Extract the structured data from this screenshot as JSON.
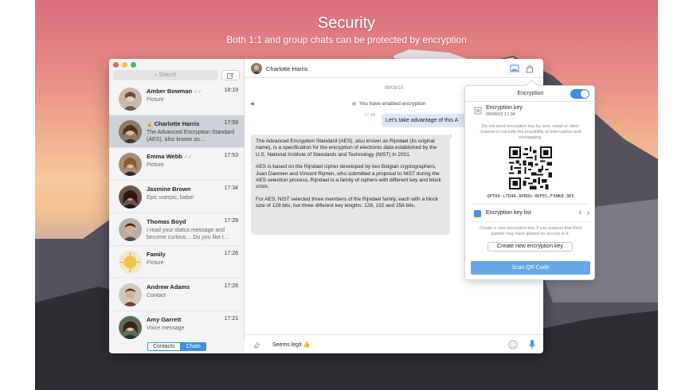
{
  "hero": {
    "title": "Security",
    "subtitle": "Both 1:1 and group chats can be protected by encryption"
  },
  "colors": {
    "accent": "#3d8fe0",
    "traffic_close": "#fc605c",
    "traffic_min": "#fdbc40",
    "traffic_max": "#34c84a"
  },
  "sidebar": {
    "search_placeholder": "Search",
    "chats": [
      {
        "name": "Amber Bowman",
        "check": "✓✓",
        "time": "18:19",
        "message": "Picture"
      },
      {
        "name": "Charlotte Harris",
        "lock": "🔒",
        "time": "17:59",
        "message": "The Advanced Encryption Standard (AES), also known as…"
      },
      {
        "name": "Emma Webb",
        "check": "✓✓",
        "time": "17:53",
        "message": "Picture"
      },
      {
        "name": "Jasmine Brown",
        "time": "17:34",
        "message": "Epic userpic, babe!"
      },
      {
        "name": "Thomas Boyd",
        "time": "17:29",
        "message": "I read your status message and become curious… Do you like t…"
      },
      {
        "name": "Family",
        "time": "17:26",
        "message": "Picture"
      },
      {
        "name": "Andrew Adams",
        "time": "17:26",
        "message": "Contact"
      },
      {
        "name": "Amy Garrett",
        "time": "17:21",
        "message": "Voice message"
      }
    ],
    "tabs": {
      "contacts": "Contacts",
      "chats": "Chats"
    }
  },
  "conversation": {
    "contact_name": "Charlotte Harris",
    "date": "09/09/15",
    "system_message": "You have enabled encryption",
    "time_out": "17:34",
    "outgoing": "Let's take advantage of this A",
    "time_in": "17:5",
    "incoming": [
      "The Advanced Encryption Standard (AES), also known as Rijndael (its original name), is a specification for the encryption of electronic data established by the U.S. National Institute of Standards and Technology (NIST) in 2001.",
      "AES is based on the Rijndael cipher developed by two Belgian cryptographers, Joan Daemen and Vincent Rijmen, who submitted a proposal to NIST during the AES selection process, Rijndael is a family of ciphers with different key and block sizes.",
      "For AES, NIST selected three members of the Rijndael family, each with a block size of 128 bits, but three different key lengths: 128, 192 and 256 bits."
    ],
    "composer_text": "Seems legit 👍"
  },
  "encryption_popover": {
    "title": "Encryption",
    "key_title": "Encryption key",
    "key_date": "09/09/15 17:34",
    "note": "Do not send encryption key by sms, email or other channel to exclude the possibility of interception and wiretapping.",
    "key_code": "QPT06-LTD46-APROU-XKFEC-F3NK8-3D5",
    "key_list_label": "Encryption key list",
    "key_list_count": "1",
    "new_key_note": "Create a new encryption key if you suspect that third parties may have gained an access to it.",
    "create_button": "Create new encryption key",
    "scan_button": "Scan QR Code"
  }
}
